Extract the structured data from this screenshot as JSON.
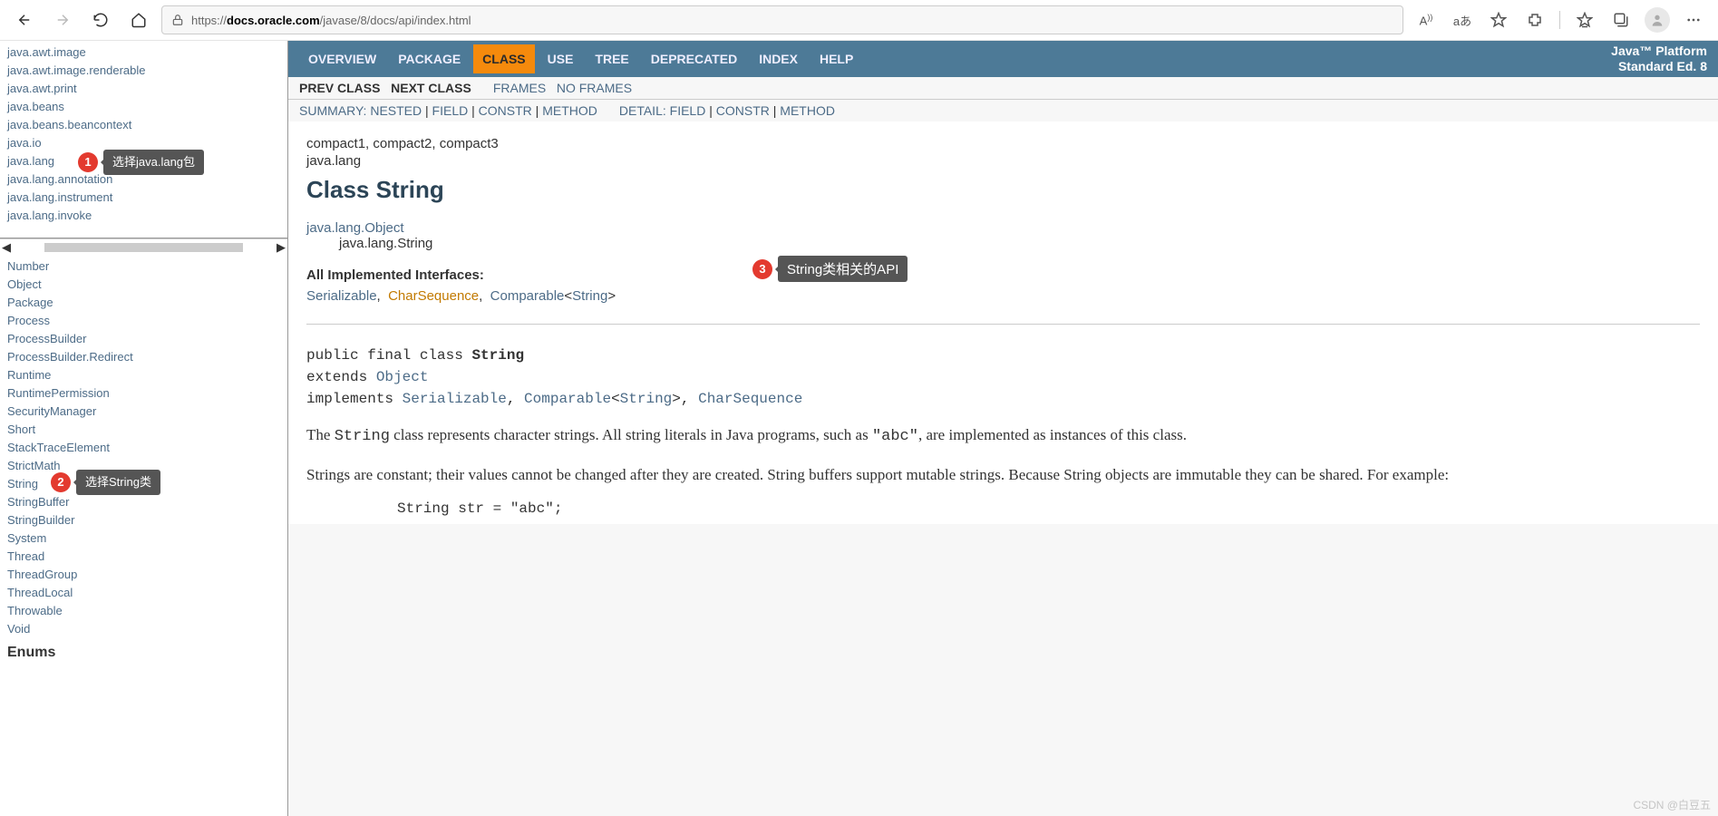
{
  "browser": {
    "url_prefix": "https://",
    "url_host": "docs.oracle.com",
    "url_path": "/javase/8/docs/api/index.html"
  },
  "platform": {
    "line1": "Java™ Platform",
    "line2": "Standard Ed. 8"
  },
  "nav_tabs": [
    "OVERVIEW",
    "PACKAGE",
    "CLASS",
    "USE",
    "TREE",
    "DEPRECATED",
    "INDEX",
    "HELP"
  ],
  "subnav": {
    "prev": "PREV CLASS",
    "next": "NEXT CLASS",
    "frames": "FRAMES",
    "noframes": "NO FRAMES",
    "summary_label": "SUMMARY:",
    "nested": "NESTED",
    "field": "FIELD",
    "constr": "CONSTR",
    "method": "METHOD",
    "detail_label": "DETAIL:",
    "dfield": "FIELD",
    "dconstr": "CONSTR",
    "dmethod": "METHOD"
  },
  "packages": [
    "java.awt.image",
    "java.awt.image.renderable",
    "java.awt.print",
    "java.beans",
    "java.beans.beancontext",
    "java.io",
    "java.lang",
    "java.lang.annotation",
    "java.lang.instrument",
    "java.lang.invoke"
  ],
  "classes": [
    "Number",
    "Object",
    "Package",
    "Process",
    "ProcessBuilder",
    "ProcessBuilder.Redirect",
    "Runtime",
    "RuntimePermission",
    "SecurityManager",
    "Short",
    "StackTraceElement",
    "StrictMath",
    "String",
    "StringBuffer",
    "StringBuilder",
    "System",
    "Thread",
    "ThreadGroup",
    "ThreadLocal",
    "Throwable",
    "Void"
  ],
  "enums_header": "Enums",
  "page": {
    "compact_line": "compact1, compact2, compact3",
    "pkg_line": "java.lang",
    "title": "Class String",
    "inherit_parent": "java.lang.Object",
    "inherit_child": "java.lang.String",
    "impl_label": "All Implemented Interfaces:",
    "impl_serializable": "Serializable",
    "impl_charsequence": "CharSequence",
    "impl_comparable": "Comparable",
    "impl_comparable_param": "String",
    "sig_line1_a": "public final class ",
    "sig_line1_b": "String",
    "sig_line2_a": "extends ",
    "sig_line2_b": "Object",
    "sig_line3_a": "implements ",
    "sig_line3_b": "Serializable",
    "sig_line3_c": "Comparable",
    "sig_line3_d": "String",
    "sig_line3_e": "CharSequence",
    "desc1_a": "The ",
    "desc1_code1": "String",
    "desc1_b": " class represents character strings. All string literals in Java programs, such as ",
    "desc1_code2": "\"abc\"",
    "desc1_c": ", are implemented as instances of this class.",
    "desc2": "Strings are constant; their values cannot be changed after they are created. String buffers support mutable strings. Because String objects are immutable they can be shared. For example:",
    "code_sample": "String str = \"abc\";"
  },
  "callouts": {
    "c1": "选择java.lang包",
    "c2": "选择String类",
    "c3": "String类相关的API"
  },
  "watermark": "CSDN @白豆五"
}
